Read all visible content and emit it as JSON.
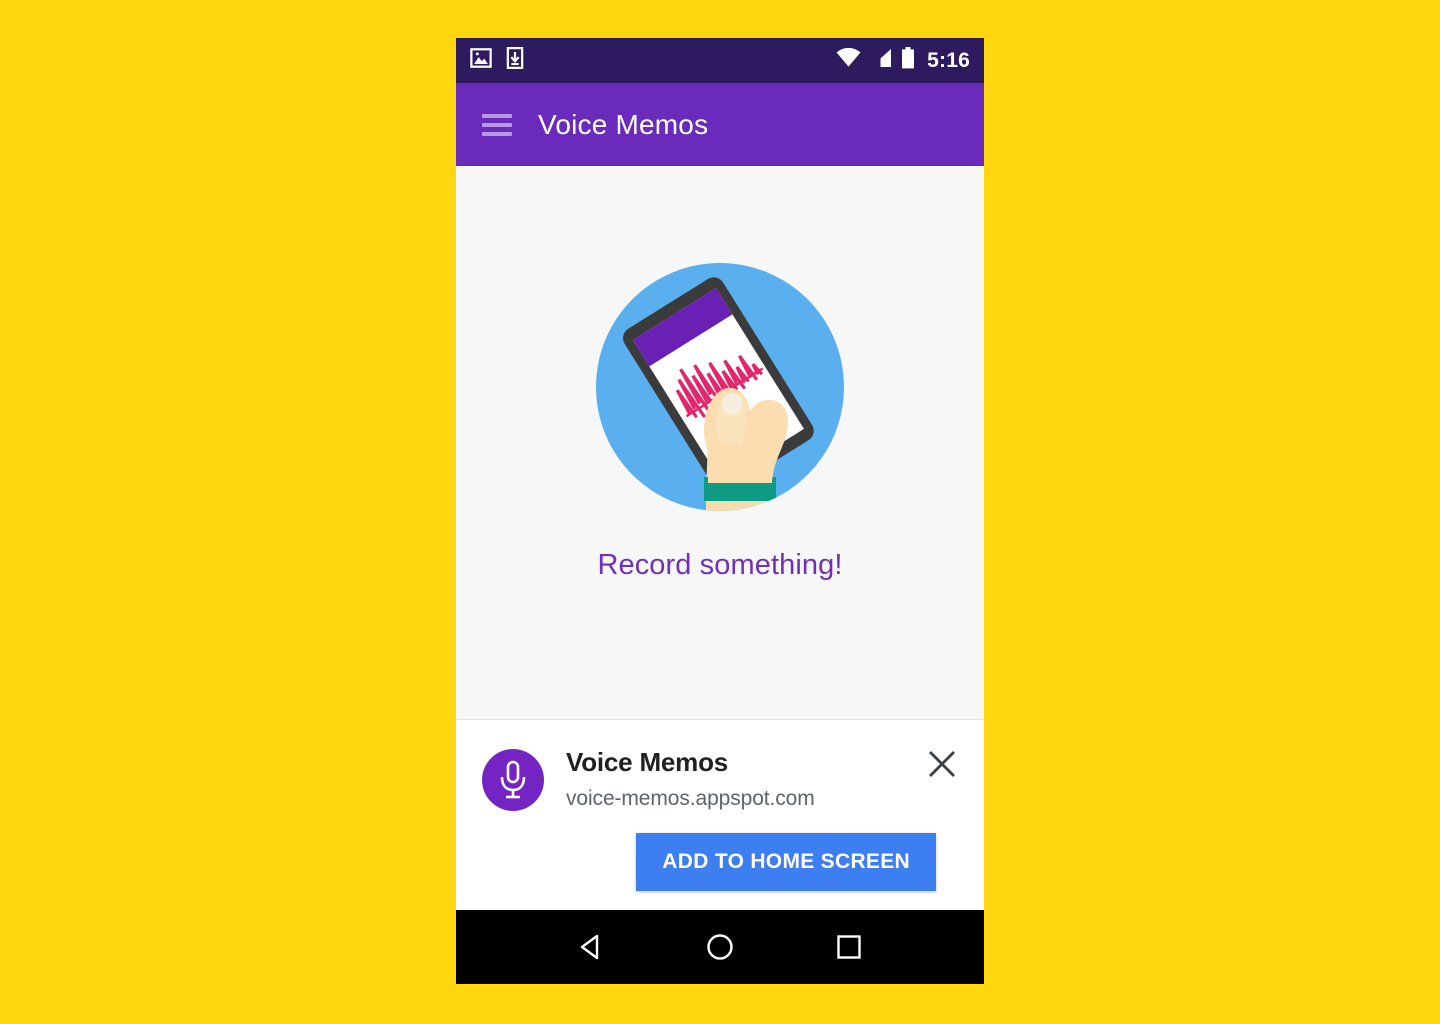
{
  "page": {
    "background_color": "#ffd60f"
  },
  "statusbar": {
    "time": "5:16",
    "left_icons": [
      "image-icon",
      "download-icon"
    ],
    "right_icons": [
      "wifi-icon",
      "cellular-signal-icon",
      "battery-icon"
    ],
    "background_color": "#2e1a5e"
  },
  "appbar": {
    "menu_icon": "hamburger-menu-icon",
    "title": "Voice Memos",
    "background_color": "#6a2bbd",
    "title_color": "#ffffff"
  },
  "content": {
    "illustration": "hand-holding-phone-recording-illustration",
    "illustration_circle_color": "#5aafef",
    "empty_state_label": "Record something!",
    "empty_state_color": "#7130b8",
    "background_color": "#f7f7f7"
  },
  "install_banner": {
    "app_icon": "microphone-icon",
    "app_icon_background": "#7524c4",
    "title": "Voice Memos",
    "url": "voice-memos.appspot.com",
    "close_icon": "close-icon",
    "cta_label": "ADD TO HOME SCREEN",
    "cta_color": "#3d7ef0"
  },
  "navbar": {
    "back_label": "back-triangle-icon",
    "home_label": "home-circle-icon",
    "recents_label": "recents-square-icon",
    "background_color": "#000000"
  }
}
